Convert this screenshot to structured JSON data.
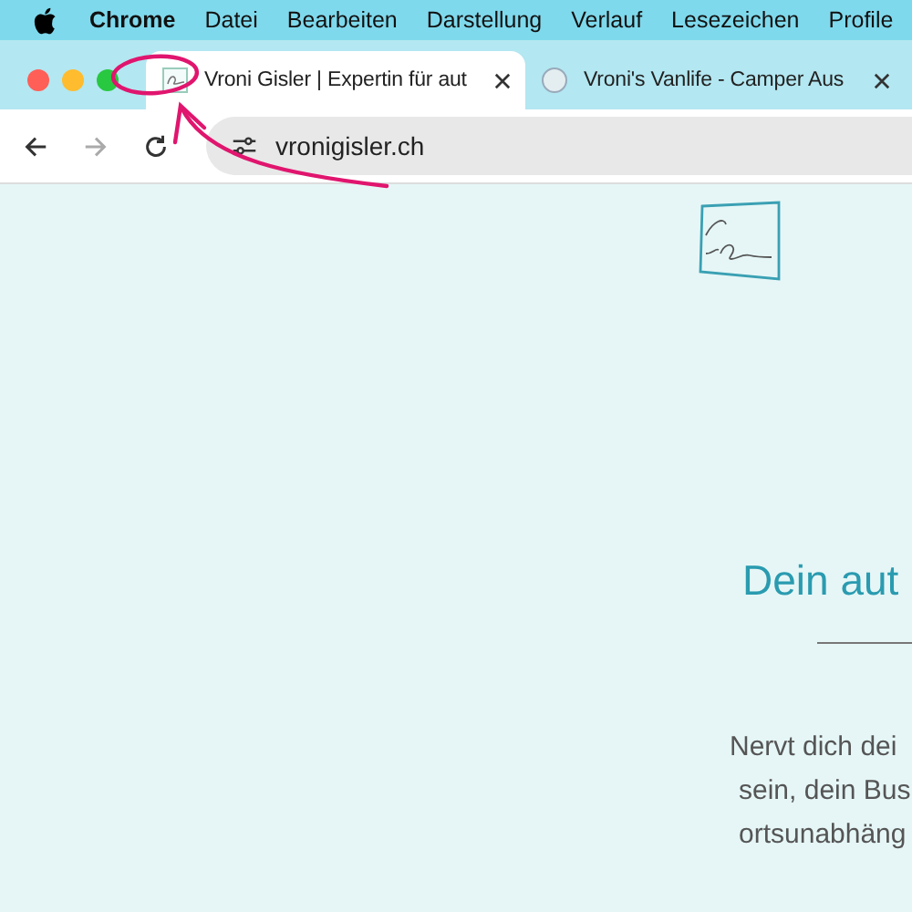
{
  "menu_bar": {
    "items": [
      {
        "label": "Chrome",
        "kind": "app"
      },
      {
        "label": "Datei",
        "kind": "menu"
      },
      {
        "label": "Bearbeiten",
        "kind": "menu"
      },
      {
        "label": "Darstellung",
        "kind": "menu"
      },
      {
        "label": "Verlauf",
        "kind": "menu"
      },
      {
        "label": "Lesezeichen",
        "kind": "menu"
      },
      {
        "label": "Profile",
        "kind": "menu"
      }
    ]
  },
  "tabs": [
    {
      "title": "Vroni Gisler | Expertin für aut",
      "selected": true
    },
    {
      "title": "Vroni's Vanlife - Camper Aus",
      "selected": false
    }
  ],
  "toolbar": {
    "forward_disabled": true,
    "url": "vronigisler.ch"
  },
  "page": {
    "heading": "Dein aut",
    "paragraph_lines": [
      "Nervt dich dei",
      "sein, dein Bus",
      "ortsunabhäng"
    ]
  }
}
